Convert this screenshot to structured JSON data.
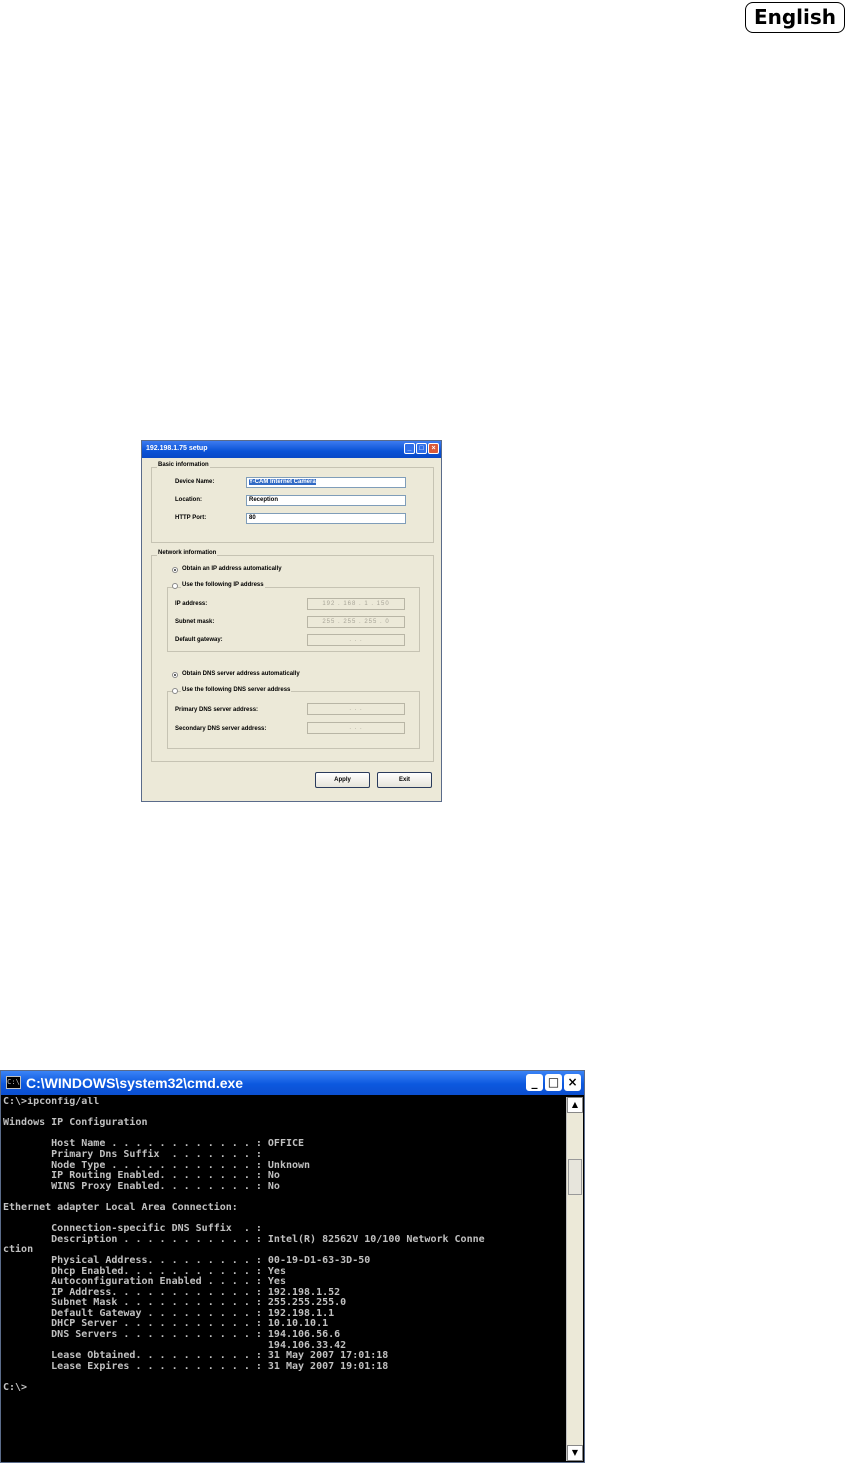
{
  "language_badge": "English",
  "setup_dialog": {
    "title": "192.198.1.75 setup",
    "basic_info": {
      "legend": "Basic information",
      "device_name_label": "Device Name:",
      "device_name_value": "Y-CAM Internet Camera",
      "location_label": "Location:",
      "location_value": "Reception",
      "http_port_label": "HTTP Port:",
      "http_port_value": "80"
    },
    "network_info": {
      "legend": "Network information",
      "obtain_ip_auto": "Obtain an IP address automatically",
      "use_following_ip": "Use the following IP address",
      "ip_address_label": "IP address:",
      "ip_address_value": "192 . 168 . 1 . 150",
      "subnet_mask_label": "Subnet mask:",
      "subnet_mask_value": "255 . 255 . 255 . 0",
      "default_gateway_label": "Default gateway:",
      "default_gateway_value": " .   .   . ",
      "obtain_dns_auto": "Obtain DNS server address automatically",
      "use_following_dns": "Use the following DNS server address",
      "primary_dns_label": "Primary DNS server address:",
      "primary_dns_value": " .   .   . ",
      "secondary_dns_label": "Secondary DNS server address:",
      "secondary_dns_value": " .   .   . "
    },
    "apply_button": "Apply",
    "exit_button": "Exit"
  },
  "cmd_window": {
    "title": "C:\\WINDOWS\\system32\\cmd.exe",
    "lines": [
      "C:\\>ipconfig/all",
      "",
      "Windows IP Configuration",
      "",
      "        Host Name . . . . . . . . . . . . : OFFICE",
      "        Primary Dns Suffix  . . . . . . . :",
      "        Node Type . . . . . . . . . . . . : Unknown",
      "        IP Routing Enabled. . . . . . . . : No",
      "        WINS Proxy Enabled. . . . . . . . : No",
      "",
      "Ethernet adapter Local Area Connection:",
      "",
      "        Connection-specific DNS Suffix  . :",
      "        Description . . . . . . . . . . . : Intel(R) 82562V 10/100 Network Conne",
      "ction",
      "        Physical Address. . . . . . . . . : 00-19-D1-63-3D-50",
      "        Dhcp Enabled. . . . . . . . . . . : Yes",
      "        Autoconfiguration Enabled . . . . : Yes",
      "        IP Address. . . . . . . . . . . . : 192.198.1.52",
      "        Subnet Mask . . . . . . . . . . . : 255.255.255.0",
      "        Default Gateway . . . . . . . . . : 192.198.1.1",
      "        DHCP Server . . . . . . . . . . . : 10.10.10.1",
      "        DNS Servers . . . . . . . . . . . : 194.106.56.6",
      "                                            194.106.33.42",
      "        Lease Obtained. . . . . . . . . . : 31 May 2007 17:01:18",
      "        Lease Expires . . . . . . . . . . : 31 May 2007 19:01:18",
      "",
      "C:\\>"
    ]
  }
}
